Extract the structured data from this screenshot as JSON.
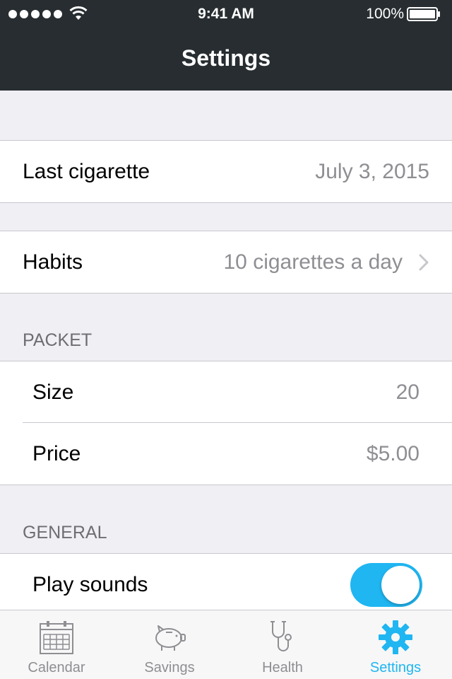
{
  "status_bar": {
    "time": "9:41 AM",
    "battery": "100%"
  },
  "nav": {
    "title": "Settings"
  },
  "rows": {
    "last_cigarette": {
      "label": "Last cigarette",
      "value": "July 3, 2015"
    },
    "habits": {
      "label": "Habits",
      "value": "10 cigarettes a day"
    }
  },
  "packet": {
    "header": "PACKET",
    "size": {
      "label": "Size",
      "value": "20"
    },
    "price": {
      "label": "Price",
      "value": "$5.00"
    }
  },
  "general": {
    "header": "GENERAL",
    "play_sounds": {
      "label": "Play sounds",
      "on": true
    }
  },
  "tabs": [
    {
      "label": "Calendar",
      "icon": "calendar-icon",
      "active": false
    },
    {
      "label": "Savings",
      "icon": "piggy-bank-icon",
      "active": false
    },
    {
      "label": "Health",
      "icon": "stethoscope-icon",
      "active": false
    },
    {
      "label": "Settings",
      "icon": "gear-icon",
      "active": true
    }
  ],
  "colors": {
    "header_bg": "#272d30",
    "accent": "#1fb6f2",
    "background": "#efeff4",
    "secondary_text": "#8e8e93"
  }
}
